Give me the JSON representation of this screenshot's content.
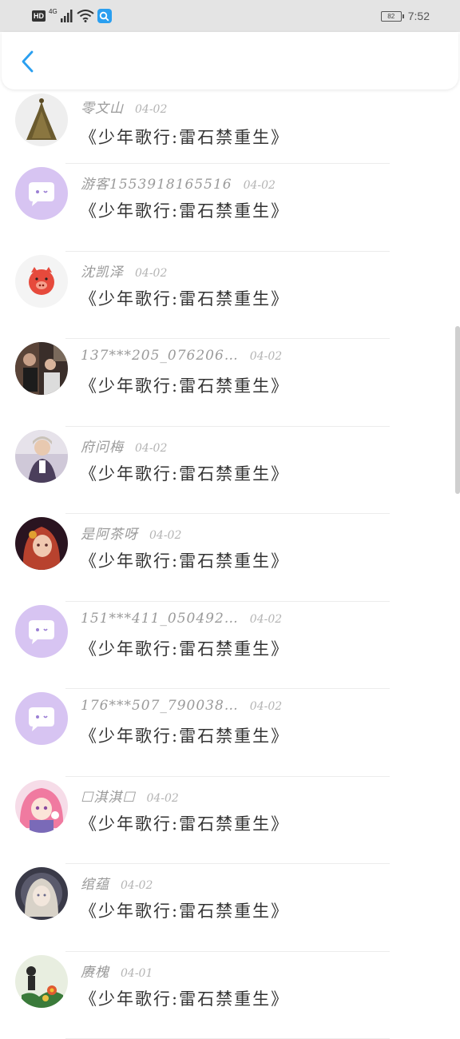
{
  "status_bar": {
    "hd": "HD",
    "network": "4G",
    "battery": "82",
    "time": "7:52"
  },
  "header": {
    "back_icon": "chevron-left-icon"
  },
  "colors": {
    "accent": "#2a9ff0",
    "chat_avatar_bg": "#d7c4f2"
  },
  "items": [
    {
      "name": "零文山",
      "date": "04-02",
      "message": "《少年歌行:雷石禁重生》",
      "avatar": "dress-photo"
    },
    {
      "name": "游客1553918165516",
      "date": "04-02",
      "message": "《少年歌行:雷石禁重生》",
      "avatar": "chat-bubble"
    },
    {
      "name": "沈凯泽",
      "date": "04-02",
      "message": "《少年歌行:雷石禁重生》",
      "avatar": "pig-face"
    },
    {
      "name": "137***205_076206…",
      "date": "04-02",
      "message": "《少年歌行:雷石禁重生》",
      "avatar": "people-photo"
    },
    {
      "name": "府问梅",
      "date": "04-02",
      "message": "《少年歌行:雷石禁重生》",
      "avatar": "person-photo"
    },
    {
      "name": "是阿茶呀",
      "date": "04-02",
      "message": "《少年歌行:雷石禁重生》",
      "avatar": "anime-red"
    },
    {
      "name": "151***411_050492…",
      "date": "04-02",
      "message": "《少年歌行:雷石禁重生》",
      "avatar": "chat-bubble"
    },
    {
      "name": "176***507_790038…",
      "date": "04-02",
      "message": "《少年歌行:雷石禁重生》",
      "avatar": "chat-bubble"
    },
    {
      "name": "☐淇淇☐",
      "date": "04-02",
      "message": "《少年歌行:雷石禁重生》",
      "avatar": "anime-pink"
    },
    {
      "name": "绾蕴",
      "date": "04-02",
      "message": "《少年歌行:雷石禁重生》",
      "avatar": "anime-pale"
    },
    {
      "name": "赓槐",
      "date": "04-01",
      "message": "《少年歌行:雷石禁重生》",
      "avatar": "flower-photo"
    }
  ]
}
